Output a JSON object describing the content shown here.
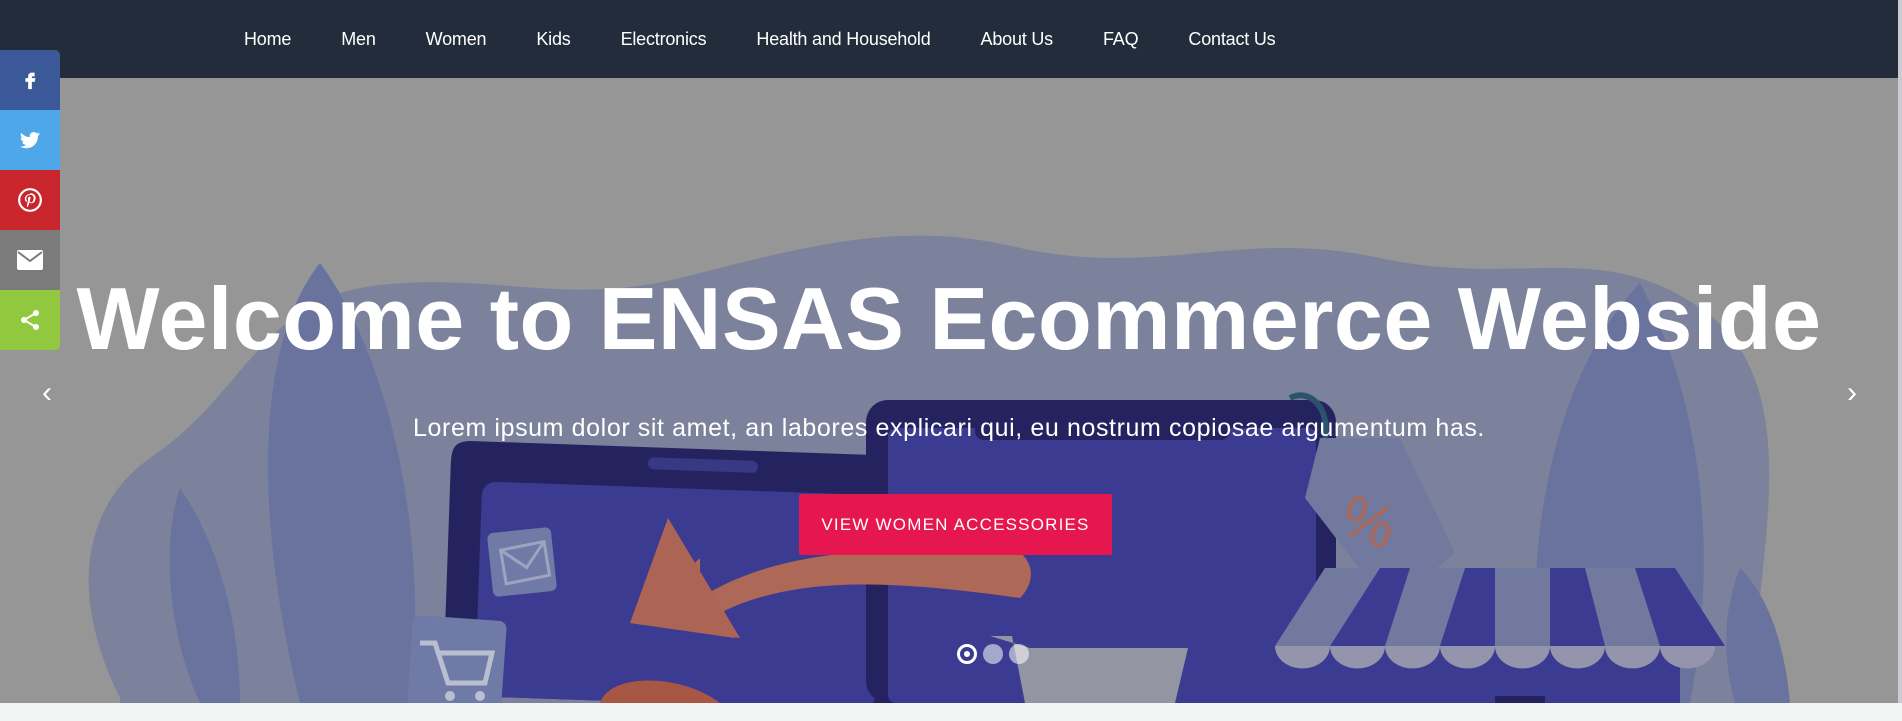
{
  "nav": {
    "items": [
      {
        "label": "Home"
      },
      {
        "label": "Men"
      },
      {
        "label": "Women"
      },
      {
        "label": "Kids"
      },
      {
        "label": "Electronics"
      },
      {
        "label": "Health and Household"
      },
      {
        "label": "About Us"
      },
      {
        "label": "FAQ"
      },
      {
        "label": "Contact Us"
      }
    ]
  },
  "hero": {
    "title": "Welcome to ENSAS Ecommerce Webside",
    "subtitle": "Lorem ipsum dolor sit amet, an labores explicari qui, eu nostrum copiosae argumentum has.",
    "button_label": "VIEW WOMEN ACCESSORIES",
    "prev_icon": "‹",
    "next_icon": "›",
    "slides_total": 3,
    "active_slide": 1
  },
  "share": {
    "items": [
      {
        "icon": "facebook-icon",
        "color": "#3b5998"
      },
      {
        "icon": "twitter-icon",
        "color": "#4da7e8"
      },
      {
        "icon": "pinterest-icon",
        "color": "#c9252c"
      },
      {
        "icon": "email-icon",
        "color": "#7b7b7b"
      },
      {
        "icon": "share-icon",
        "color": "#92c83e"
      }
    ]
  },
  "colors": {
    "nav_bg": "#232c3a",
    "accent": "#e5174e",
    "illustration_purple": "#2e2f96",
    "illustration_orange": "#c7604a"
  }
}
